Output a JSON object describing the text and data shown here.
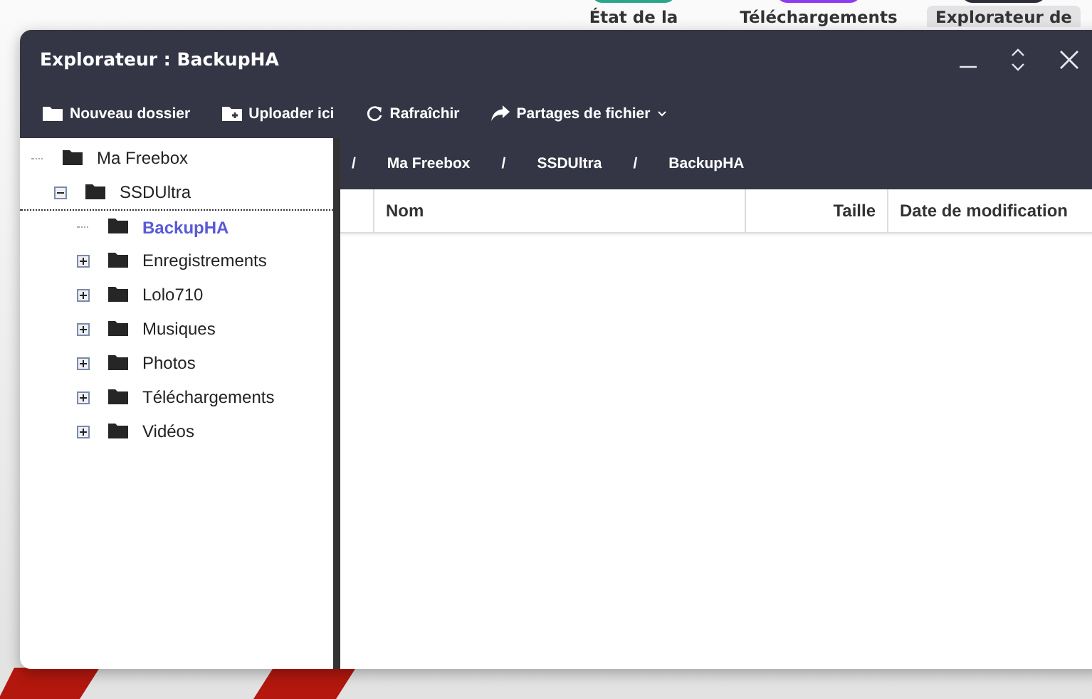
{
  "desktop_apps": [
    {
      "label": "État de la",
      "color": "#2aa58e",
      "selected": false
    },
    {
      "label": "Téléchargements",
      "color": "#8f3cf0",
      "selected": false
    },
    {
      "label": "Explorateur de",
      "color": "#2c2e3b",
      "selected": true
    }
  ],
  "window": {
    "title": "Explorateur : BackupHA"
  },
  "toolbar": [
    {
      "label": "Nouveau dossier",
      "kind": "folder"
    },
    {
      "label": "Uploader ici",
      "kind": "upload"
    },
    {
      "label": "Rafraîchir",
      "kind": "refresh"
    },
    {
      "label": "Partages de fichier",
      "kind": "share",
      "dropdown": true
    }
  ],
  "tree": [
    {
      "label": "Ma Freebox",
      "selected": false,
      "children": [
        {
          "label": "SSDUltra",
          "expanded": true,
          "selected": false,
          "children": [
            {
              "label": "BackupHA",
              "selected": true
            },
            {
              "label": "Enregistrements",
              "expanded": false,
              "selected": false
            },
            {
              "label": "Lolo710",
              "expanded": false,
              "selected": false
            },
            {
              "label": "Musiques",
              "expanded": false,
              "selected": false
            },
            {
              "label": "Photos",
              "expanded": false,
              "selected": false
            },
            {
              "label": "Téléchargements",
              "expanded": false,
              "selected": false
            },
            {
              "label": "Vidéos",
              "expanded": false,
              "selected": false
            }
          ]
        }
      ]
    }
  ],
  "breadcrumb": [
    "Ma Freebox",
    "SSDUltra",
    "BackupHA"
  ],
  "breadcrumb_separator": "/",
  "table": {
    "columns": [
      "Nom",
      "Taille",
      "Date de modification"
    ]
  }
}
